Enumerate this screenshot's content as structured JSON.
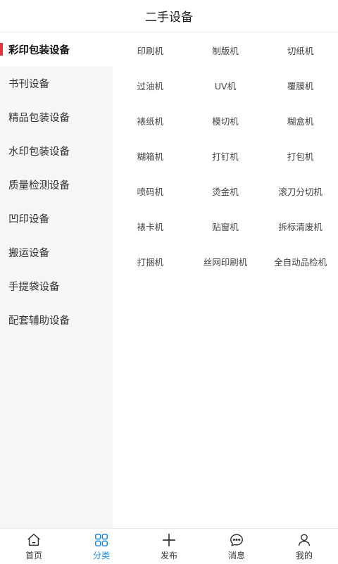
{
  "header": {
    "title": "二手设备"
  },
  "sidebar": {
    "items": [
      {
        "label": "彩印包装设备",
        "active": true
      },
      {
        "label": "书刊设备"
      },
      {
        "label": "精品包装设备"
      },
      {
        "label": "水印包装设备"
      },
      {
        "label": "质量检测设备"
      },
      {
        "label": "凹印设备"
      },
      {
        "label": "搬运设备"
      },
      {
        "label": "手提袋设备"
      },
      {
        "label": "配套辅助设备"
      }
    ]
  },
  "grid": {
    "items": [
      "印刷机",
      "制版机",
      "切纸机",
      "过油机",
      "UV机",
      "覆膜机",
      "裱纸机",
      "模切机",
      "糊盒机",
      "糊箱机",
      "打钉机",
      "打包机",
      "喷码机",
      "烫金机",
      "滚刀分切机",
      "裱卡机",
      "贴窗机",
      "拆标清废机",
      "打捆机",
      "丝网印刷机",
      "全自动品检机"
    ]
  },
  "tabbar": {
    "tabs": [
      {
        "label": "首页",
        "icon": "home-icon"
      },
      {
        "label": "分类",
        "icon": "category-icon",
        "active": true
      },
      {
        "label": "发布",
        "icon": "plus-icon"
      },
      {
        "label": "消息",
        "icon": "message-icon"
      },
      {
        "label": "我的",
        "icon": "user-icon"
      }
    ],
    "active_color": "#1e88e5",
    "inactive_color": "#333333"
  },
  "accent_color": "#e5323b"
}
